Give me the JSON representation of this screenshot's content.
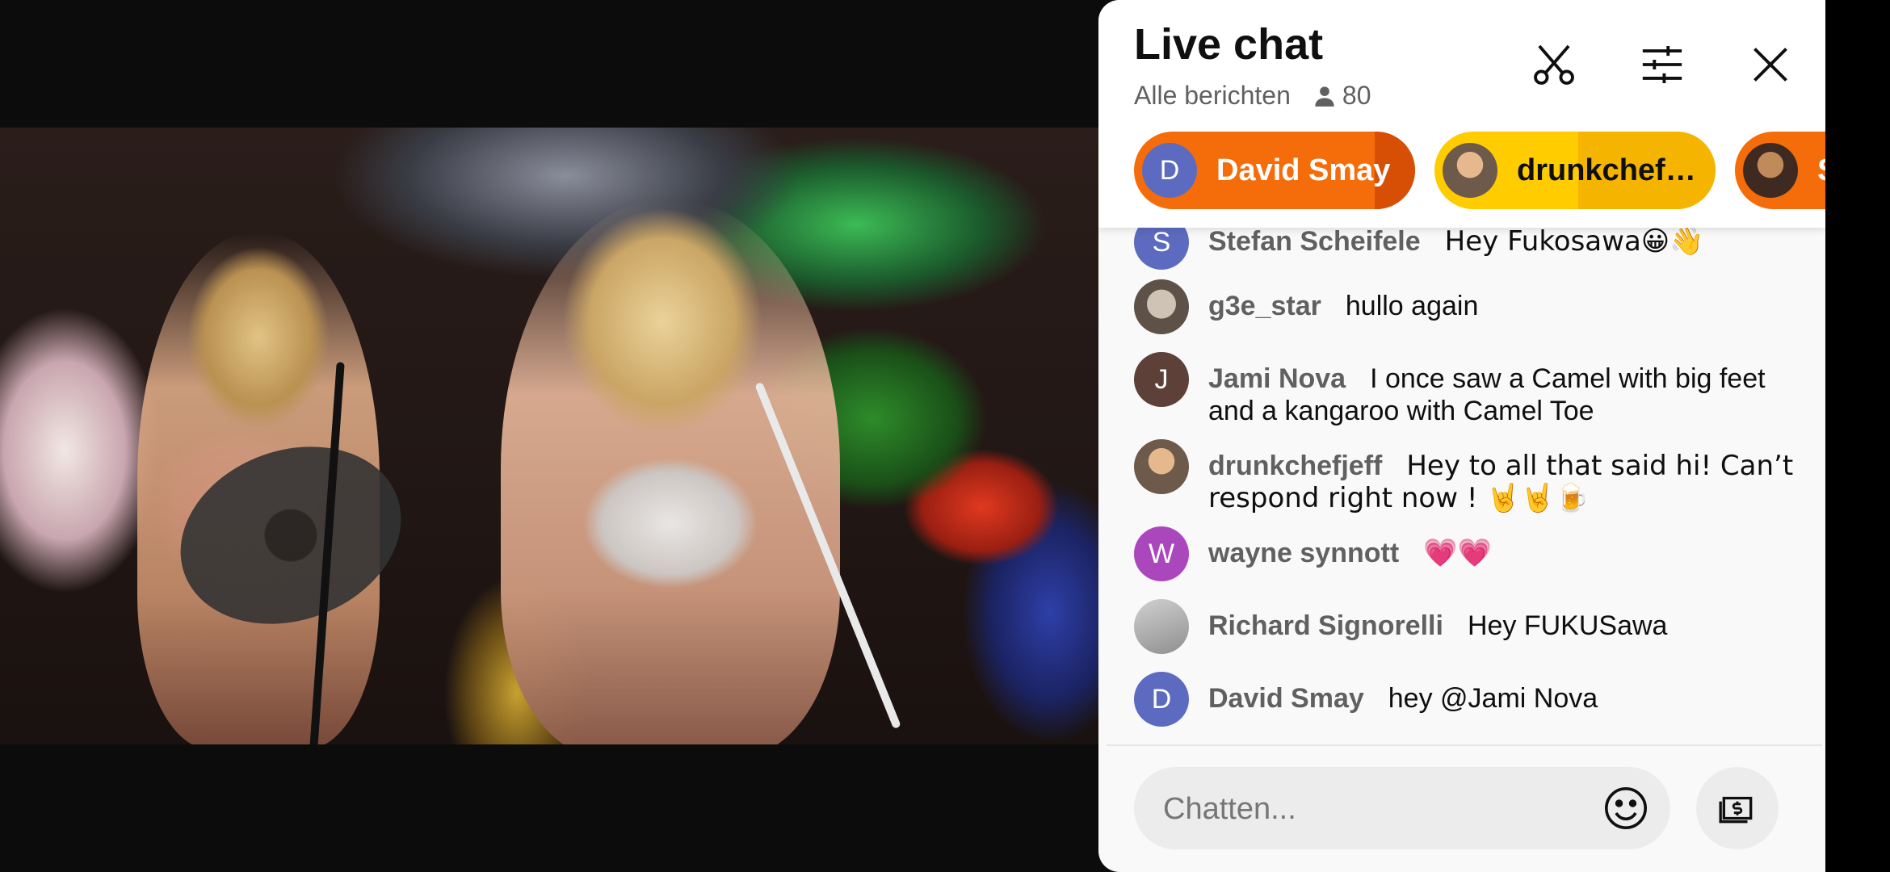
{
  "video": {
    "description_icon": "video-frame"
  },
  "chat": {
    "title": "Live chat",
    "subtitle": "Alle berichten",
    "viewer_count": "80",
    "icons": {
      "clip": "scissors-icon",
      "filter": "sliders-icon",
      "close": "close-icon"
    },
    "pinned": [
      {
        "initial": "D",
        "name": "David Smay",
        "avatar_color": "#5c6bc0"
      },
      {
        "initial": "",
        "name": "drunkchef…",
        "avatar_color": "#8d6e63"
      },
      {
        "initial": "",
        "name": "S",
        "avatar_color": "#6d4c41"
      }
    ],
    "messages": [
      {
        "initial": "S",
        "avatar_color": "#5c6bc0",
        "author": "Stefan Scheifele",
        "text": "Hey Fukosawa😀👋"
      },
      {
        "initial": "",
        "avatar_color": "#7b6e62",
        "author": "g3e_star",
        "text": "hullo again"
      },
      {
        "initial": "J",
        "avatar_color": "#5d4037",
        "author": "Jami Nova",
        "text": "I once saw a Camel with big feet and a kangaroo with Camel Toe"
      },
      {
        "initial": "",
        "avatar_color": "#8d6e63",
        "author": "drunkchefjeff",
        "text": "Hey to all that said hi! Can’t respond right now ! 🤘🤘🍺"
      },
      {
        "initial": "W",
        "avatar_color": "#ab47bc",
        "author": "wayne synnott",
        "text": "💗💗"
      },
      {
        "initial": "",
        "avatar_color": "#9e9e9e",
        "author": "Richard Signorelli",
        "text": "Hey FUKUSawa"
      },
      {
        "initial": "D",
        "avatar_color": "#5c6bc0",
        "author": "David Smay",
        "text": "hey @Jami Nova"
      }
    ],
    "input_placeholder": "Chatten...",
    "emoji_icon": "emoji-icon",
    "super_chat_icon": "dollar-icon"
  },
  "colors": {
    "accent_orange": "#f56c0a",
    "accent_yellow": "#ffcc00"
  }
}
